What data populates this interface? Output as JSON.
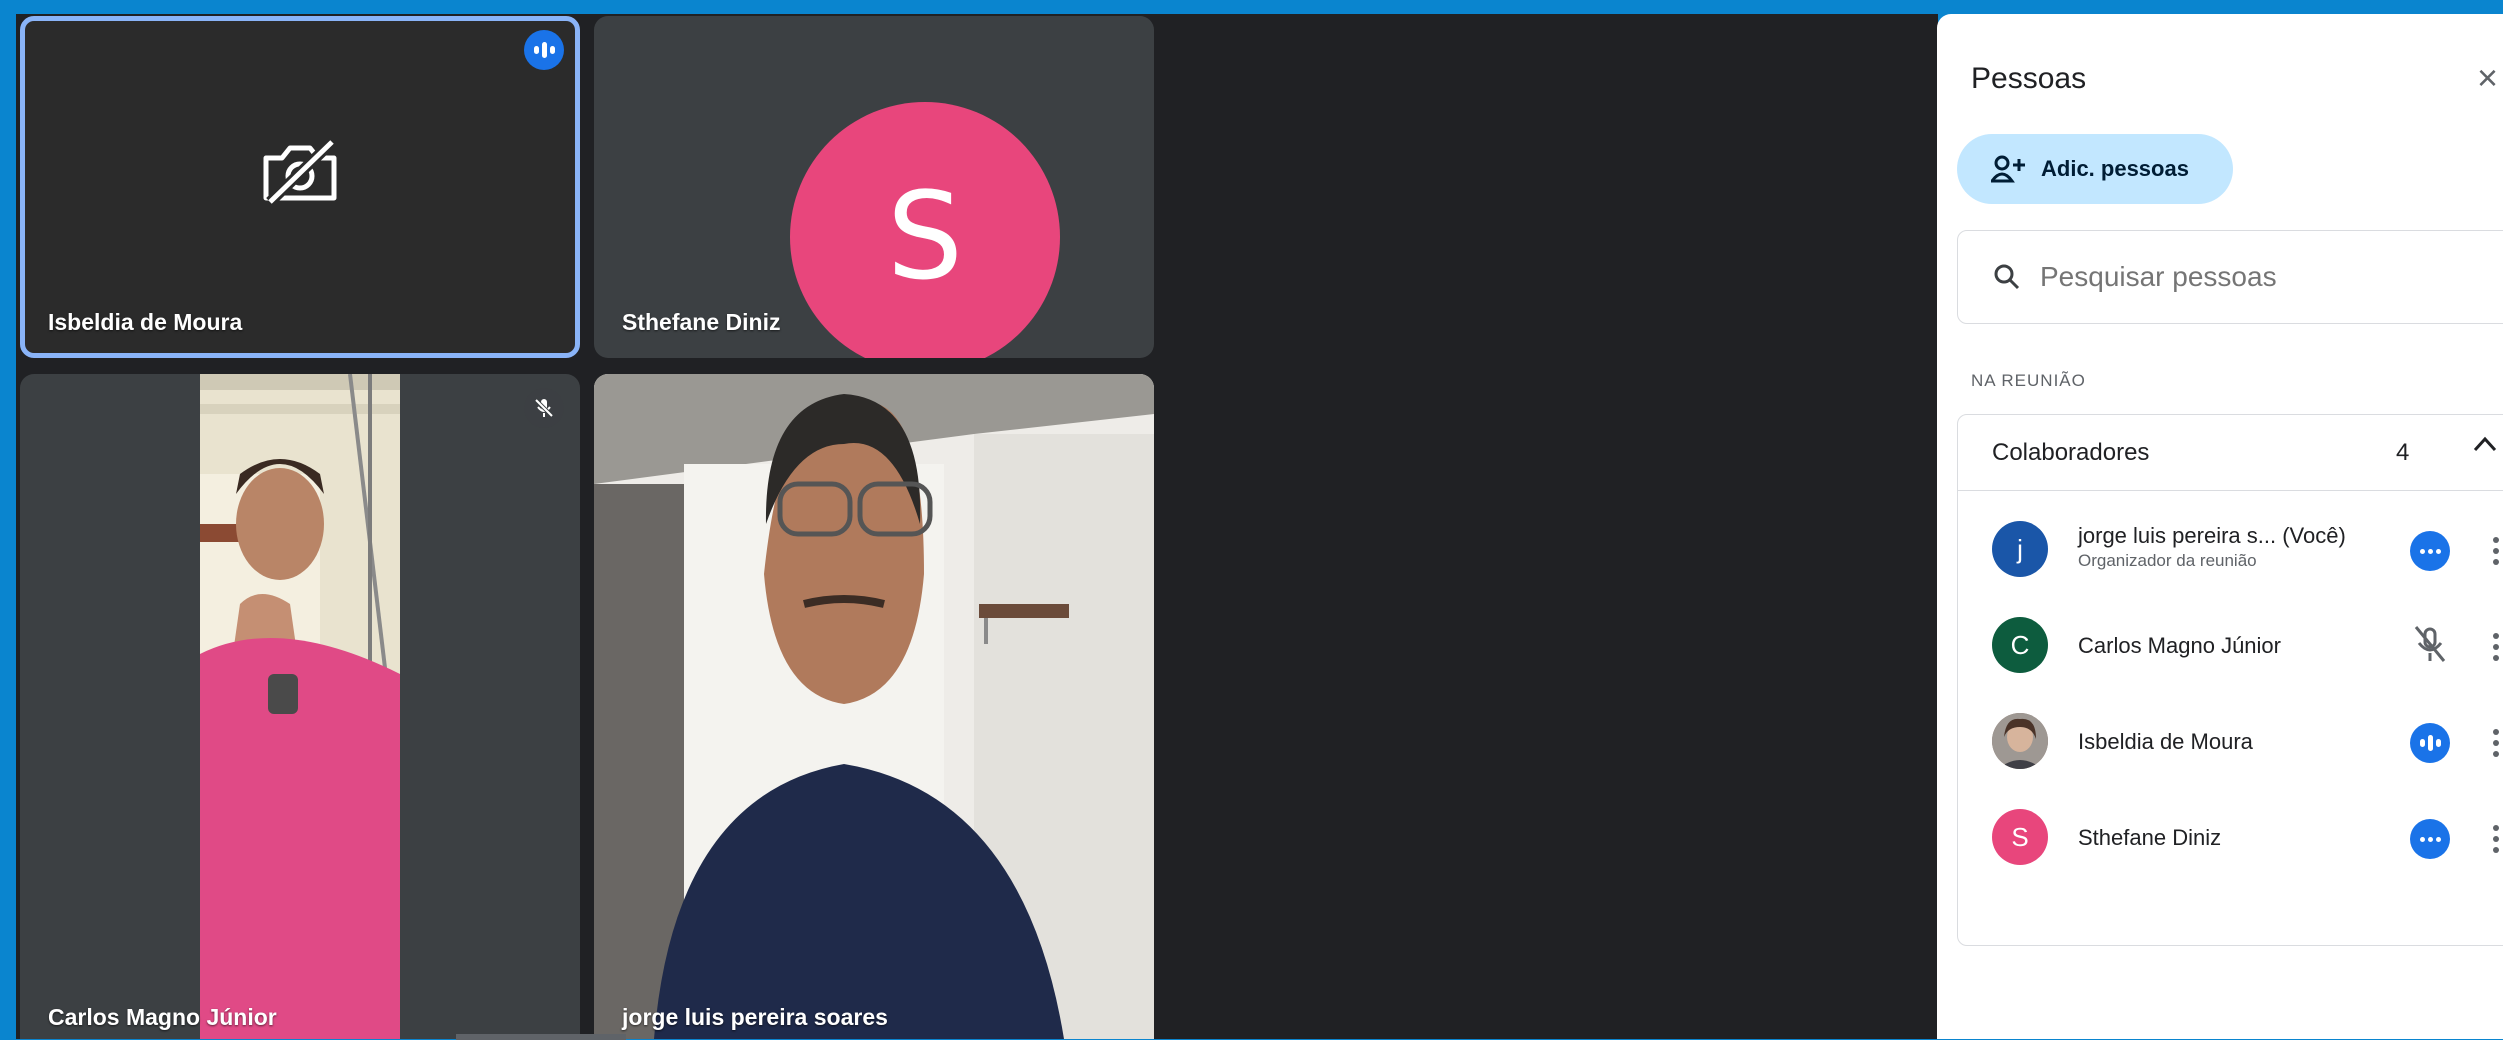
{
  "tiles": [
    {
      "name": "Isbeldia de Moura",
      "state": "camera-off",
      "speaking": true
    },
    {
      "name": "Sthefane Diniz",
      "avatar_letter": "S",
      "avatar_color": "#e8467c"
    },
    {
      "name": "Carlos Magno Júnior",
      "state": "video",
      "muted": true
    },
    {
      "name": "jorge luis pereira soares",
      "state": "video"
    }
  ],
  "panel": {
    "title": "Pessoas",
    "close_icon": "×",
    "add_label": "Adic. pessoas",
    "search_placeholder": "Pesquisar pessoas",
    "section_label": "NA REUNIÃO",
    "group": {
      "title": "Colaboradores",
      "count": "4"
    },
    "people": [
      {
        "letter": "j",
        "name": "jorge luis pereira s... (Você)",
        "subtitle": "Organizador da reunião",
        "color": "#1a56a8",
        "status": "more-dots"
      },
      {
        "letter": "C",
        "name": "Carlos Magno Júnior",
        "subtitle": "",
        "color": "#0d5c3e",
        "status": "mic-off"
      },
      {
        "letter": "",
        "name": "Isbeldia de Moura",
        "subtitle": "",
        "color": "#8d6e63",
        "status": "speaking"
      },
      {
        "letter": "S",
        "name": "Sthefane Diniz",
        "subtitle": "",
        "color": "#e8467c",
        "status": "more-dots"
      }
    ]
  },
  "colors": {
    "frame": "#0a85cf",
    "meet_bg": "#202124",
    "tile_bg": "#3c4043",
    "accent": "#1a73e8",
    "active_outline": "#8ab4f8"
  }
}
